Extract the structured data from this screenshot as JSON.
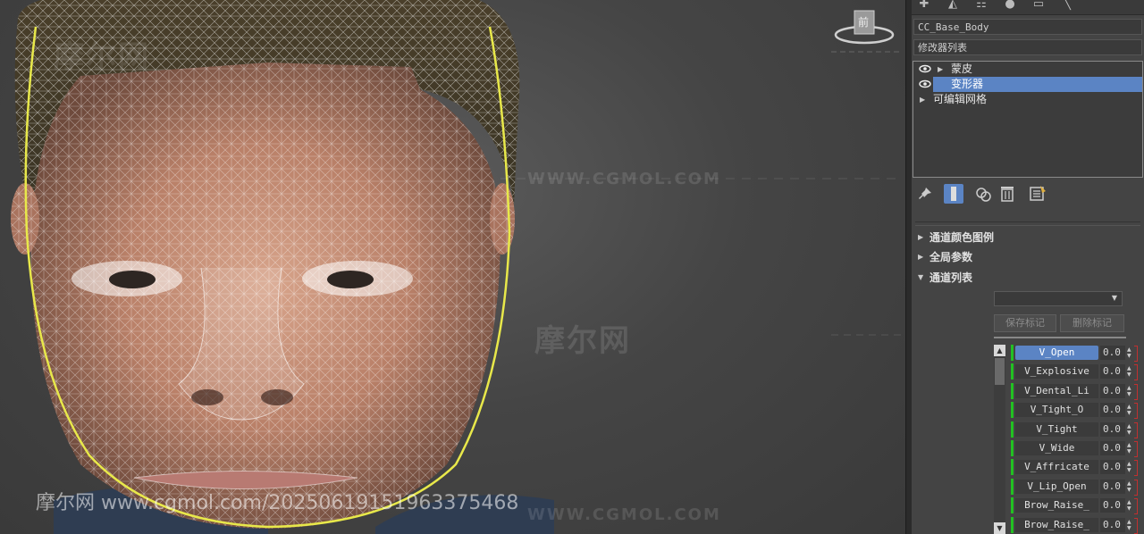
{
  "viewport": {
    "watermark_url": "WWW.CGMOL.COM",
    "watermark_cn": "摩尔网",
    "viewcube_label": "前",
    "bottom_watermark": "摩尔网 www.cgmol.com/20250619151963375468"
  },
  "panel": {
    "top_tabs": [
      "create-icon",
      "modify-icon",
      "hierarchy-icon",
      "motion-icon",
      "display-icon",
      "utilities-icon"
    ],
    "object_name": "CC_Base_Body",
    "modifier_list_label": "修改器列表",
    "modifiers": [
      {
        "label": "蒙皮",
        "eye": true,
        "expandable": true,
        "selected": false
      },
      {
        "label": "变形器",
        "eye": true,
        "expandable": false,
        "selected": true
      },
      {
        "label": "可编辑网格",
        "eye": false,
        "expandable": true,
        "selected": false
      }
    ],
    "rollouts": {
      "channel_color_legend": "通道颜色图例",
      "global_params": "全局参数",
      "channel_list": "通道列表"
    },
    "buttons": {
      "save_marker": "保存标记",
      "delete_marker": "删除标记"
    },
    "channels": [
      {
        "name": "V_Open",
        "value": "0.0",
        "active": true
      },
      {
        "name": "V_Explosive",
        "value": "0.0",
        "active": false
      },
      {
        "name": "V_Dental_Li",
        "value": "0.0",
        "active": false
      },
      {
        "name": "V_Tight_O",
        "value": "0.0",
        "active": false
      },
      {
        "name": "V_Tight",
        "value": "0.0",
        "active": false
      },
      {
        "name": "V_Wide",
        "value": "0.0",
        "active": false
      },
      {
        "name": "V_Affricate",
        "value": "0.0",
        "active": false
      },
      {
        "name": "V_Lip_Open",
        "value": "0.0",
        "active": false
      },
      {
        "name": "Brow_Raise_",
        "value": "0.0",
        "active": false
      },
      {
        "name": "Brow_Raise_",
        "value": "0.0",
        "active": false
      }
    ],
    "colors": {
      "selection": "#5b84c4",
      "channel_active_bar": "#22c122"
    }
  }
}
